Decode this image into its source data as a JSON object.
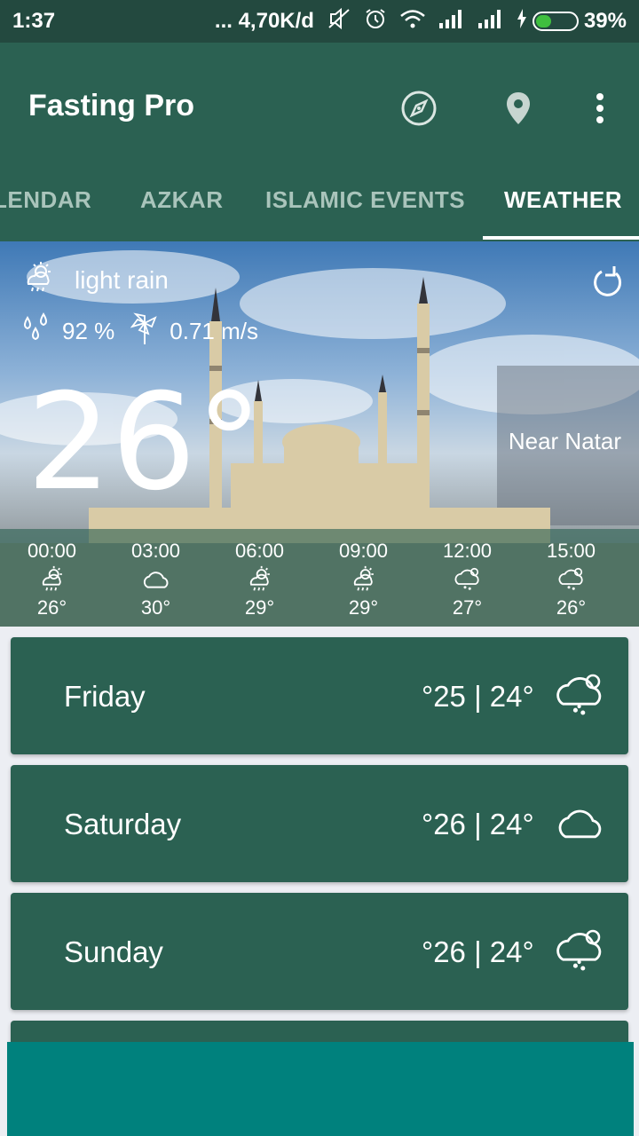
{
  "status_bar": {
    "time": "1:37",
    "network_speed": "... 4,70K/d",
    "battery": "39%",
    "battery_level": 0.39,
    "icons": [
      "mute-icon",
      "alarm-icon",
      "wifi-icon",
      "signal-icon",
      "signal-icon",
      "charging-icon"
    ]
  },
  "app_bar": {
    "title": "Fasting Pro",
    "actions": [
      "compass-icon",
      "location-pin-icon",
      "more-vert-icon"
    ]
  },
  "tabs": [
    {
      "label": "CALENDAR",
      "visible_label": "LENDAR",
      "active": false
    },
    {
      "label": "AZKAR",
      "active": false
    },
    {
      "label": "ISLAMIC EVENTS",
      "active": false
    },
    {
      "label": "WEATHER",
      "active": true
    }
  ],
  "current": {
    "condition": "light rain",
    "condition_icon": "sun-rain-icon",
    "humidity": "92 %",
    "humidity_icon": "raindrops-icon",
    "wind": "0.71 m/s",
    "wind_icon": "pinwheel-icon",
    "temperature": "26°",
    "location": "Near Natar",
    "refresh_icon": "refresh-icon"
  },
  "hourly": [
    {
      "time": "00:00",
      "icon": "sun-rain-icon",
      "temp": "26°"
    },
    {
      "time": "03:00",
      "icon": "cloud-icon",
      "temp": "30°"
    },
    {
      "time": "06:00",
      "icon": "sun-rain-icon",
      "temp": "29°"
    },
    {
      "time": "09:00",
      "icon": "sun-rain-icon",
      "temp": "29°"
    },
    {
      "time": "12:00",
      "icon": "cloud-sun-rain-icon",
      "temp": "27°"
    },
    {
      "time": "15:00",
      "icon": "cloud-sun-rain-icon",
      "temp": "26°"
    }
  ],
  "daily": [
    {
      "day": "Friday",
      "temps": "°25 | 24°",
      "icon": "cloud-sun-rain-icon"
    },
    {
      "day": "Saturday",
      "temps": "°26 | 24°",
      "icon": "cloud-icon"
    },
    {
      "day": "Sunday",
      "temps": "°26 | 24°",
      "icon": "cloud-sun-rain-icon"
    }
  ],
  "colors": {
    "primary": "#2b6152",
    "status_bar": "#23493f",
    "banner": "#00817d",
    "background": "#eceef3"
  }
}
